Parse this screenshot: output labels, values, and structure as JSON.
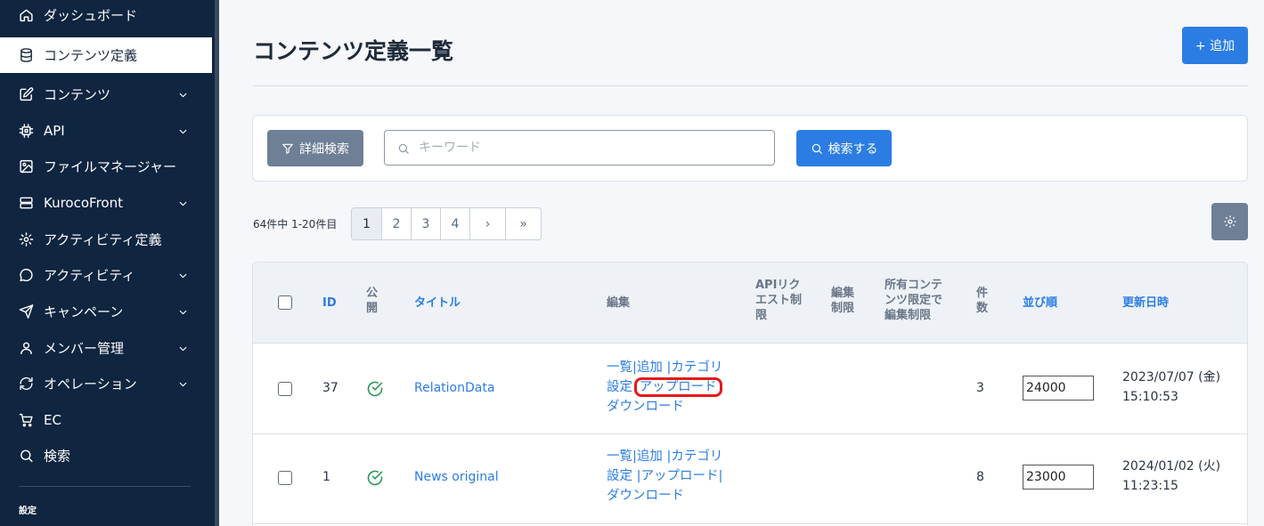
{
  "sidebar": {
    "items": [
      {
        "label": "ダッシュボード",
        "icon": "home-icon",
        "chevron": false
      },
      {
        "label": "コンテンツ定義",
        "icon": "database-icon",
        "chevron": false,
        "active": true
      },
      {
        "label": "コンテンツ",
        "icon": "edit-icon",
        "chevron": true
      },
      {
        "label": "API",
        "icon": "chip-icon",
        "chevron": true
      },
      {
        "label": "ファイルマネージャー",
        "icon": "image-icon",
        "chevron": false
      },
      {
        "label": "KurocoFront",
        "icon": "server-icon",
        "chevron": true
      },
      {
        "label": "アクティビティ定義",
        "icon": "gear-icon",
        "chevron": false
      },
      {
        "label": "アクティビティ",
        "icon": "chat-icon",
        "chevron": true
      },
      {
        "label": "キャンペーン",
        "icon": "send-icon",
        "chevron": true
      },
      {
        "label": "メンバー管理",
        "icon": "user-icon",
        "chevron": true
      },
      {
        "label": "オペレーション",
        "icon": "refresh-icon",
        "chevron": true
      },
      {
        "label": "EC",
        "icon": "cart-icon",
        "chevron": false
      },
      {
        "label": "検索",
        "icon": "search-icon",
        "chevron": false
      }
    ],
    "section_label": "設定"
  },
  "header": {
    "title": "コンテンツ定義一覧",
    "add_label": "+ 追加"
  },
  "search": {
    "advanced_label": "詳細検索",
    "placeholder": "キーワード",
    "value": "",
    "submit_label": "検索する"
  },
  "pagination": {
    "summary": "64件中 1-20件目",
    "pages": [
      "1",
      "2",
      "3",
      "4",
      "›",
      "»"
    ],
    "current": "1"
  },
  "table": {
    "headers": {
      "id": "ID",
      "public": [
        "公",
        "開"
      ],
      "title": "タイトル",
      "edit": "編集",
      "api_limit": [
        "APIリク",
        "エスト制",
        "限"
      ],
      "edit_limit": [
        "編集",
        "制限"
      ],
      "owner_limit": [
        "所有コンテ",
        "ンツ限定で",
        "編集制限"
      ],
      "count": [
        "件",
        "数"
      ],
      "order": "並び順",
      "updated": "更新日時"
    },
    "rows": [
      {
        "id": "37",
        "title": "RelationData",
        "edit_line1": "一覧|追加 |カテゴリ",
        "edit_line2a": "設定",
        "edit_line2b": "アップロード",
        "edit_line2c": "",
        "edit_line3": "ダウンロード",
        "count": "3",
        "order": "24000",
        "updated_date": "2023/07/07 (金)",
        "updated_time": "15:10:53"
      },
      {
        "id": "1",
        "title": "News original",
        "edit_line1": "一覧|追加 |カテゴリ",
        "edit_line2a": "設定 |",
        "edit_line2b": "アップロード",
        "edit_line2c": "|",
        "edit_line3": "ダウンロード",
        "count": "8",
        "order": "23000",
        "updated_date": "2024/01/02 (火)",
        "updated_time": "11:23:15"
      }
    ]
  },
  "colors": {
    "sidebar_bg": "#0f2540",
    "primary": "#2b7de3",
    "secondary_button": "#6e7f96",
    "highlight": "#e21b1b",
    "check_green": "#2e9a5a"
  }
}
